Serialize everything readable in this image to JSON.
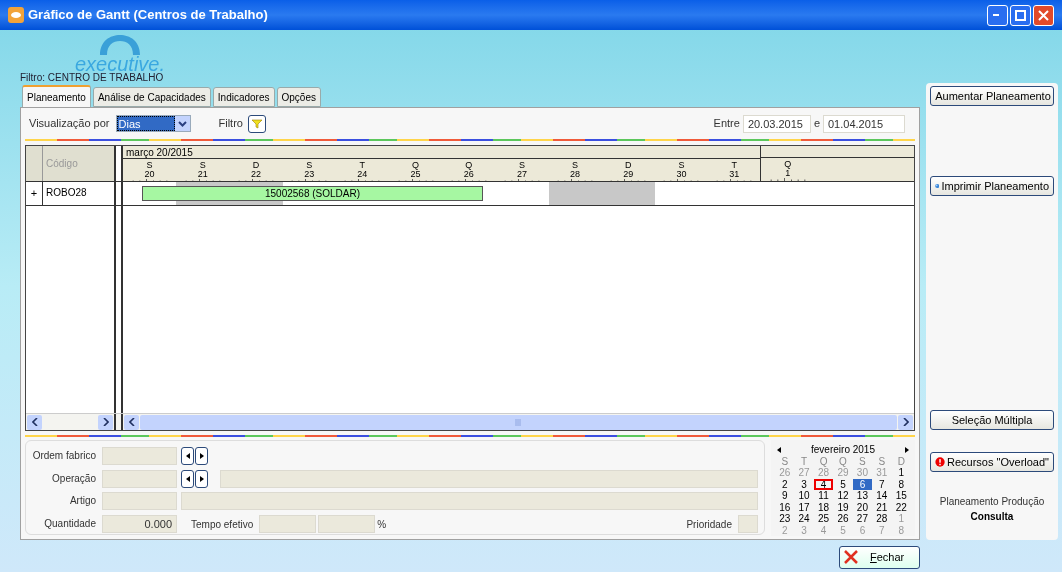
{
  "window": {
    "title": "Gráfico de Gantt (Centros de Trabalho)"
  },
  "logo": {
    "text": "executive."
  },
  "filter_caption": "Filtro: CENTRO DE TRABALHO",
  "tabs": [
    {
      "label": "Planeamento",
      "selected": true
    },
    {
      "label": "Análise de Capacidades",
      "selected": false
    },
    {
      "label": "Indicadores",
      "selected": false
    },
    {
      "label": "Opções",
      "selected": false
    }
  ],
  "toolbar": {
    "view_label": "Visualização por",
    "view_value": "Dias",
    "filter_label": "Filtro",
    "range_label": "Entre",
    "range_from": "20.03.2015",
    "range_sep": "e",
    "range_to": "01.04.2015"
  },
  "gantt": {
    "code_header": "Código",
    "months": [
      {
        "label": "março 20/2015",
        "days": [
          {
            "letter": "S",
            "number": "20",
            "weekend": false
          },
          {
            "letter": "S",
            "number": "21",
            "weekend": true
          },
          {
            "letter": "D",
            "number": "22",
            "weekend": true
          },
          {
            "letter": "S",
            "number": "23",
            "weekend": false
          },
          {
            "letter": "T",
            "number": "24",
            "weekend": false
          },
          {
            "letter": "Q",
            "number": "25",
            "weekend": false
          },
          {
            "letter": "Q",
            "number": "26",
            "weekend": false
          },
          {
            "letter": "S",
            "number": "27",
            "weekend": false
          },
          {
            "letter": "S",
            "number": "28",
            "weekend": true
          },
          {
            "letter": "D",
            "number": "29",
            "weekend": true
          },
          {
            "letter": "S",
            "number": "30",
            "weekend": false
          },
          {
            "letter": "T",
            "number": "31",
            "weekend": false
          }
        ]
      },
      {
        "days": [
          {
            "letter": "Q",
            "number": "1",
            "weekend": false
          }
        ]
      }
    ],
    "rows": [
      {
        "expander": "+",
        "code": "ROBO28",
        "task": "15002568 (SOLDAR)"
      }
    ]
  },
  "details": {
    "order_label": "Ordem fabrico",
    "operation_label": "Operação",
    "article_label": "Artigo",
    "quantity_label": "Quantidade",
    "quantity_value": "0.000",
    "effective_time_label": "Tempo efetivo",
    "percent": "%",
    "priority_label": "Prioridade"
  },
  "calendar": {
    "title": "fevereiro 2015",
    "weekdays": [
      "S",
      "T",
      "Q",
      "Q",
      "S",
      "S",
      "D"
    ],
    "weeks": [
      [
        {
          "d": "26",
          "muted": true,
          "today": false,
          "selected": false
        },
        {
          "d": "27",
          "muted": true,
          "today": false,
          "selected": false
        },
        {
          "d": "28",
          "muted": true,
          "today": false,
          "selected": false
        },
        {
          "d": "29",
          "muted": true,
          "today": false,
          "selected": false
        },
        {
          "d": "30",
          "muted": true,
          "today": false,
          "selected": false
        },
        {
          "d": "31",
          "muted": true,
          "today": false,
          "selected": false
        },
        {
          "d": "1",
          "muted": false,
          "today": false,
          "selected": false
        }
      ],
      [
        {
          "d": "2",
          "muted": false,
          "today": false,
          "selected": false
        },
        {
          "d": "3",
          "muted": false,
          "today": false,
          "selected": false
        },
        {
          "d": "4",
          "muted": false,
          "today": true,
          "selected": false
        },
        {
          "d": "5",
          "muted": false,
          "today": false,
          "selected": false
        },
        {
          "d": "6",
          "muted": false,
          "today": false,
          "selected": true
        },
        {
          "d": "7",
          "muted": false,
          "today": false,
          "selected": false
        },
        {
          "d": "8",
          "muted": false,
          "today": false,
          "selected": false
        }
      ],
      [
        {
          "d": "9",
          "muted": false,
          "today": false,
          "selected": false
        },
        {
          "d": "10",
          "muted": false,
          "today": false,
          "selected": false
        },
        {
          "d": "11",
          "muted": false,
          "today": false,
          "selected": false
        },
        {
          "d": "12",
          "muted": false,
          "today": false,
          "selected": false
        },
        {
          "d": "13",
          "muted": false,
          "today": false,
          "selected": false
        },
        {
          "d": "14",
          "muted": false,
          "today": false,
          "selected": false
        },
        {
          "d": "15",
          "muted": false,
          "today": false,
          "selected": false
        }
      ],
      [
        {
          "d": "16",
          "muted": false,
          "today": false,
          "selected": false
        },
        {
          "d": "17",
          "muted": false,
          "today": false,
          "selected": false
        },
        {
          "d": "18",
          "muted": false,
          "today": false,
          "selected": false
        },
        {
          "d": "19",
          "muted": false,
          "today": false,
          "selected": false
        },
        {
          "d": "20",
          "muted": false,
          "today": false,
          "selected": false
        },
        {
          "d": "21",
          "muted": false,
          "today": false,
          "selected": false
        },
        {
          "d": "22",
          "muted": false,
          "today": false,
          "selected": false
        }
      ],
      [
        {
          "d": "23",
          "muted": false,
          "today": false,
          "selected": false
        },
        {
          "d": "24",
          "muted": false,
          "today": false,
          "selected": false
        },
        {
          "d": "25",
          "muted": false,
          "today": false,
          "selected": false
        },
        {
          "d": "26",
          "muted": false,
          "today": false,
          "selected": false
        },
        {
          "d": "27",
          "muted": false,
          "today": false,
          "selected": false
        },
        {
          "d": "28",
          "muted": false,
          "today": false,
          "selected": false
        },
        {
          "d": "1",
          "muted": true,
          "today": false,
          "selected": false
        }
      ],
      [
        {
          "d": "2",
          "muted": true,
          "today": false,
          "selected": false
        },
        {
          "d": "3",
          "muted": true,
          "today": false,
          "selected": false
        },
        {
          "d": "4",
          "muted": true,
          "today": false,
          "selected": false
        },
        {
          "d": "5",
          "muted": true,
          "today": false,
          "selected": false
        },
        {
          "d": "6",
          "muted": true,
          "today": false,
          "selected": false
        },
        {
          "d": "7",
          "muted": true,
          "today": false,
          "selected": false
        },
        {
          "d": "8",
          "muted": true,
          "today": false,
          "selected": false
        }
      ]
    ]
  },
  "side_panel": {
    "top_buttons": [
      {
        "label": "Aumentar Planeamento"
      },
      {
        "label": "Imprimir Planeamento"
      }
    ],
    "bottom_buttons": [
      {
        "label": "Seleção Múltipla"
      },
      {
        "label": "Recursos \"Overload\""
      }
    ],
    "mode_caption": "Planeamento Produção",
    "mode": "Consulta"
  },
  "close_button": "Fechar"
}
